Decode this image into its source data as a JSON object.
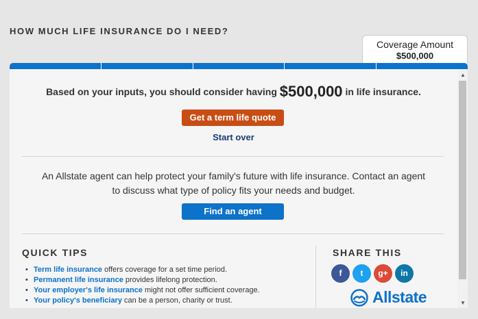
{
  "page": {
    "title": "HOW MUCH LIFE INSURANCE DO I NEED?"
  },
  "coverage": {
    "label": "Coverage Amount",
    "value": "$500,000"
  },
  "progress": {
    "completed_steps": 5,
    "total_steps": 5
  },
  "result": {
    "prefix": "Based on your inputs, you should consider having",
    "amount": "$500,000",
    "suffix": "in life insurance.",
    "quote_button": "Get a term life quote",
    "start_over": "Start over"
  },
  "agent": {
    "text": "An Allstate agent can help protect your family's future with life insurance. Contact an agent to discuss what type of policy fits your needs and budget.",
    "button": "Find an agent"
  },
  "tips": {
    "title": "QUICK TIPS",
    "items": [
      {
        "link": "Term life insurance",
        "text": "offers coverage for a set time period."
      },
      {
        "link": "Permanent life insurance",
        "text": "provides lifelong protection."
      },
      {
        "link": "Your employer's life insurance",
        "text": "might not offer sufficient coverage."
      },
      {
        "link": "Your policy's beneficiary",
        "text": "can be a person, charity or trust."
      }
    ]
  },
  "share": {
    "title": "SHARE THIS",
    "icons": [
      {
        "name": "facebook-icon",
        "glyph": "f"
      },
      {
        "name": "twitter-icon",
        "glyph": "t"
      },
      {
        "name": "google-plus-icon",
        "glyph": "g+"
      },
      {
        "name": "linkedin-icon",
        "glyph": "in"
      }
    ]
  },
  "brand": {
    "logo_text": "Allstate",
    "accent": "#0d72c9",
    "cta_color": "#c84d15"
  }
}
